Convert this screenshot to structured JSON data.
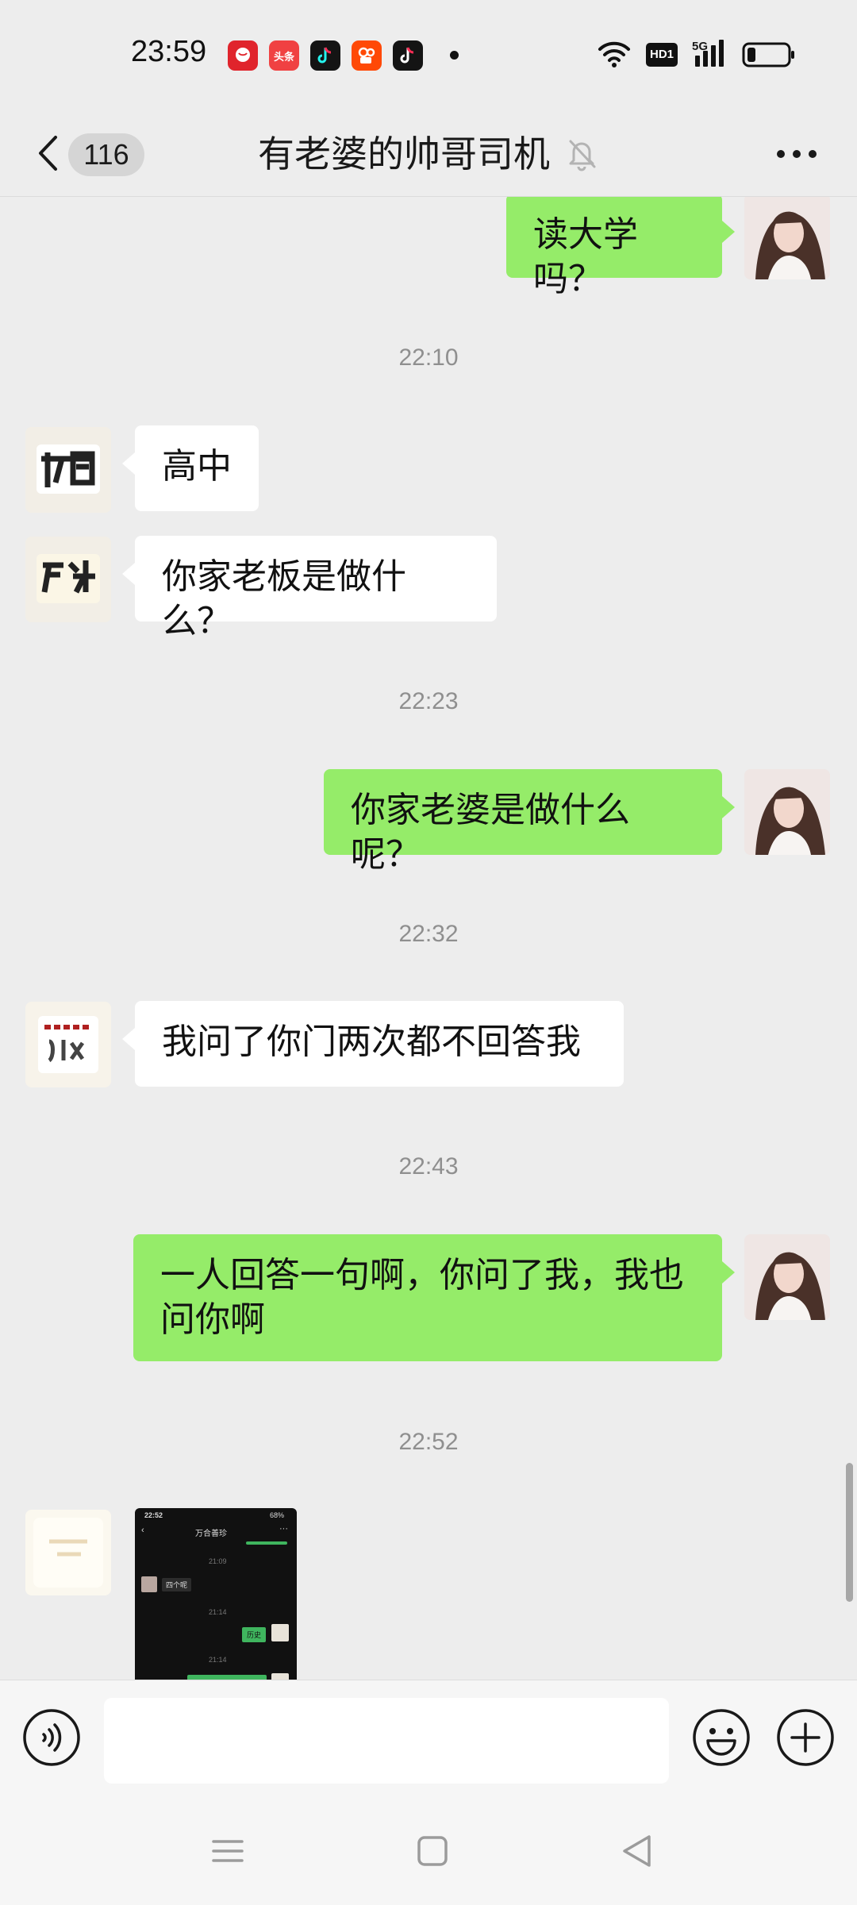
{
  "status_bar": {
    "time": "23:59",
    "app_icons": [
      {
        "name": "pinduoduo-app-icon",
        "label": "",
        "color": "#e0242c"
      },
      {
        "name": "toutiao-app-icon",
        "label": "头条",
        "color": "#f04142"
      },
      {
        "name": "douyin-lite-app-icon",
        "label": "",
        "color": "#141414"
      },
      {
        "name": "kuaishou-app-icon",
        "label": "",
        "color": "#ff4906"
      },
      {
        "name": "douyin-app-icon",
        "label": "",
        "color": "#141414"
      }
    ],
    "network_badge": "HD1",
    "network_type": "5G"
  },
  "header": {
    "unread_count": "116",
    "title": "有老婆的帅哥司机"
  },
  "messages": [
    {
      "sender": "self",
      "text": "读大学吗？"
    },
    {
      "type": "time",
      "text": "22:10"
    },
    {
      "sender": "other",
      "text": "高中"
    },
    {
      "sender": "other",
      "text": "你家老板是做什么？"
    },
    {
      "type": "time",
      "text": "22:23"
    },
    {
      "sender": "self",
      "text": "你家老婆是做什么呢？"
    },
    {
      "type": "time",
      "text": "22:32"
    },
    {
      "sender": "other",
      "text": "我问了你门两次都不回答我"
    },
    {
      "type": "time",
      "text": "22:43"
    },
    {
      "sender": "self",
      "text": "一人回答一句啊，你问了我，我也问你啊"
    },
    {
      "type": "time",
      "text": "22:52"
    },
    {
      "sender": "other",
      "type": "image",
      "thumbnail": {
        "status_time": "22:52",
        "status_battery": "68%",
        "title": "万合善珍",
        "time_1": "21:09",
        "msg_1": "四个呢",
        "time_2": "21:14",
        "msg_2": "历史",
        "time_3": "21:14"
      }
    }
  ],
  "colors": {
    "background": "#ededed",
    "self_bubble": "#95ec69",
    "other_bubble": "#ffffff",
    "timestamp_text": "#8f8f8f"
  },
  "input_bar": {
    "value": "",
    "placeholder": ""
  },
  "icons": {
    "back": "chevron-left-icon",
    "mute": "bell-off-icon",
    "more": "more-horizontal-icon",
    "voice": "voice-icon",
    "emoji": "emoji-icon",
    "plus": "plus-circle-icon",
    "nav_menu": "menu-icon",
    "nav_home": "home-square-icon",
    "nav_back": "triangle-back-icon"
  }
}
